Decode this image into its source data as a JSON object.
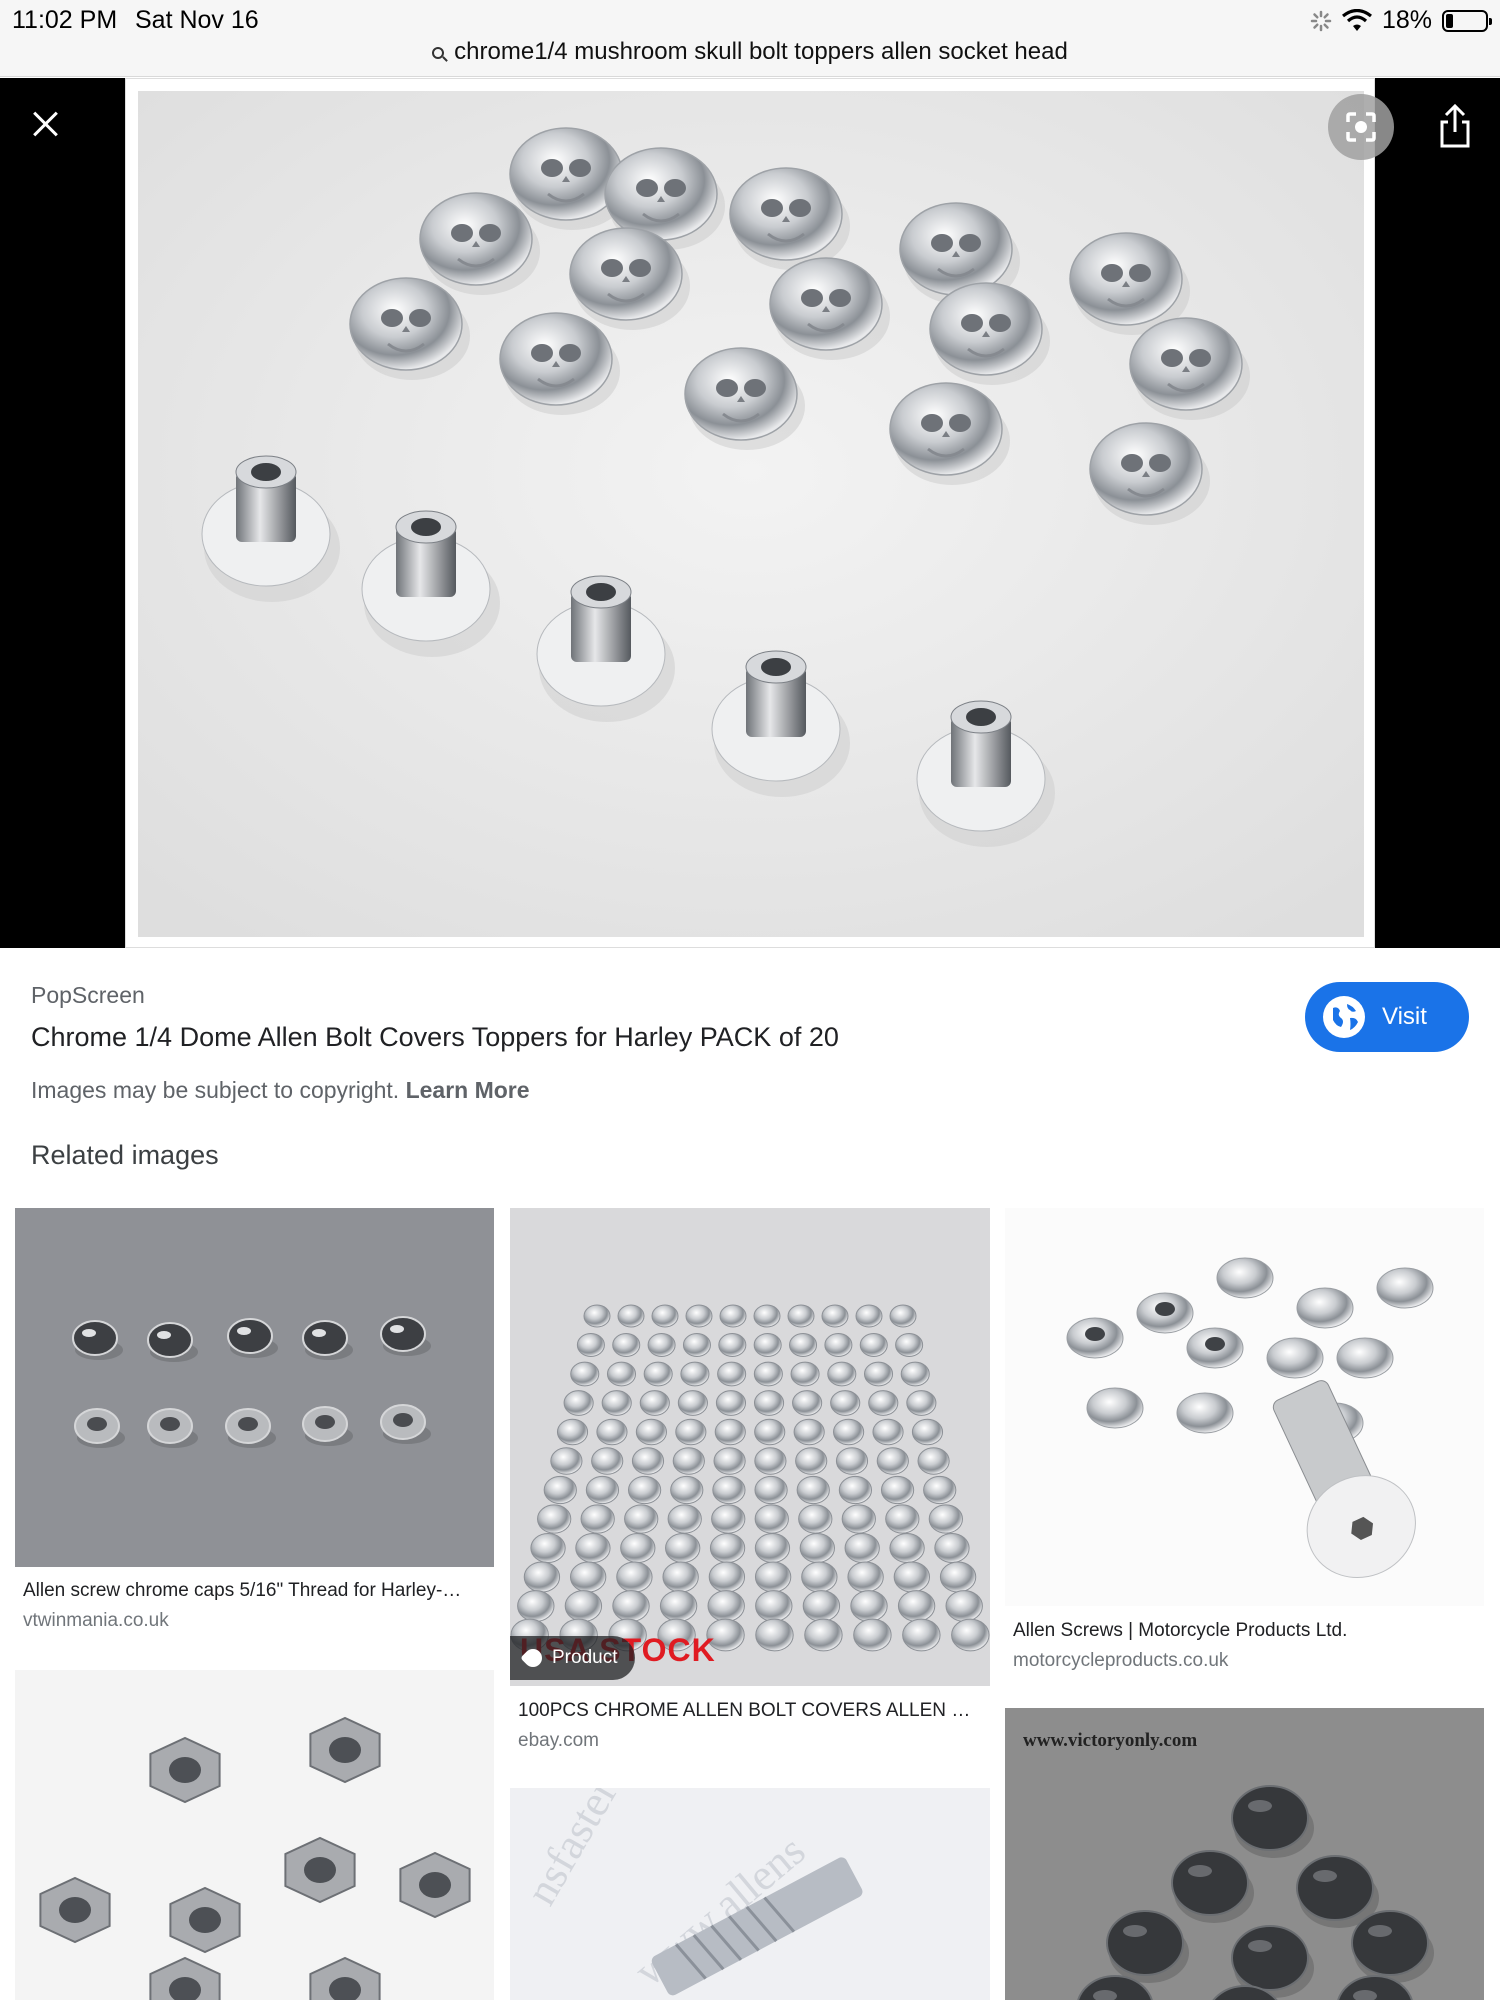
{
  "status": {
    "time": "11:02 PM",
    "date": "Sat Nov 16",
    "battery": "18%",
    "battery_level": 0.18
  },
  "search": {
    "query": "chrome1/4 mushroom skull bolt toppers allen socket head"
  },
  "result": {
    "source": "PopScreen",
    "title": "Chrome 1/4 Dome Allen Bolt Covers Toppers for Harley PACK of 20",
    "copyright_text": "Images may be subject to copyright.",
    "learn_more": "Learn More",
    "visit_label": "Visit"
  },
  "related": {
    "heading": "Related images",
    "items": [
      {
        "title": "Allen screw chrome caps 5/16\" Thread for Harley-…",
        "site": "vtwinmania.co.uk"
      },
      {
        "title": "100PCS CHROME ALLEN BOLT COVERS ALLEN B…",
        "site": "ebay.com",
        "badge": "Product",
        "overlay_text": "USA STOCK"
      },
      {
        "title": "Allen Screws | Motorcycle Products Ltd.",
        "site": "motorcycleproducts.co.uk"
      },
      {
        "overlay_text": "www.victoryonly.com"
      }
    ]
  },
  "colors": {
    "accent": "#1a73e8",
    "stock_red": "#e01b22"
  }
}
